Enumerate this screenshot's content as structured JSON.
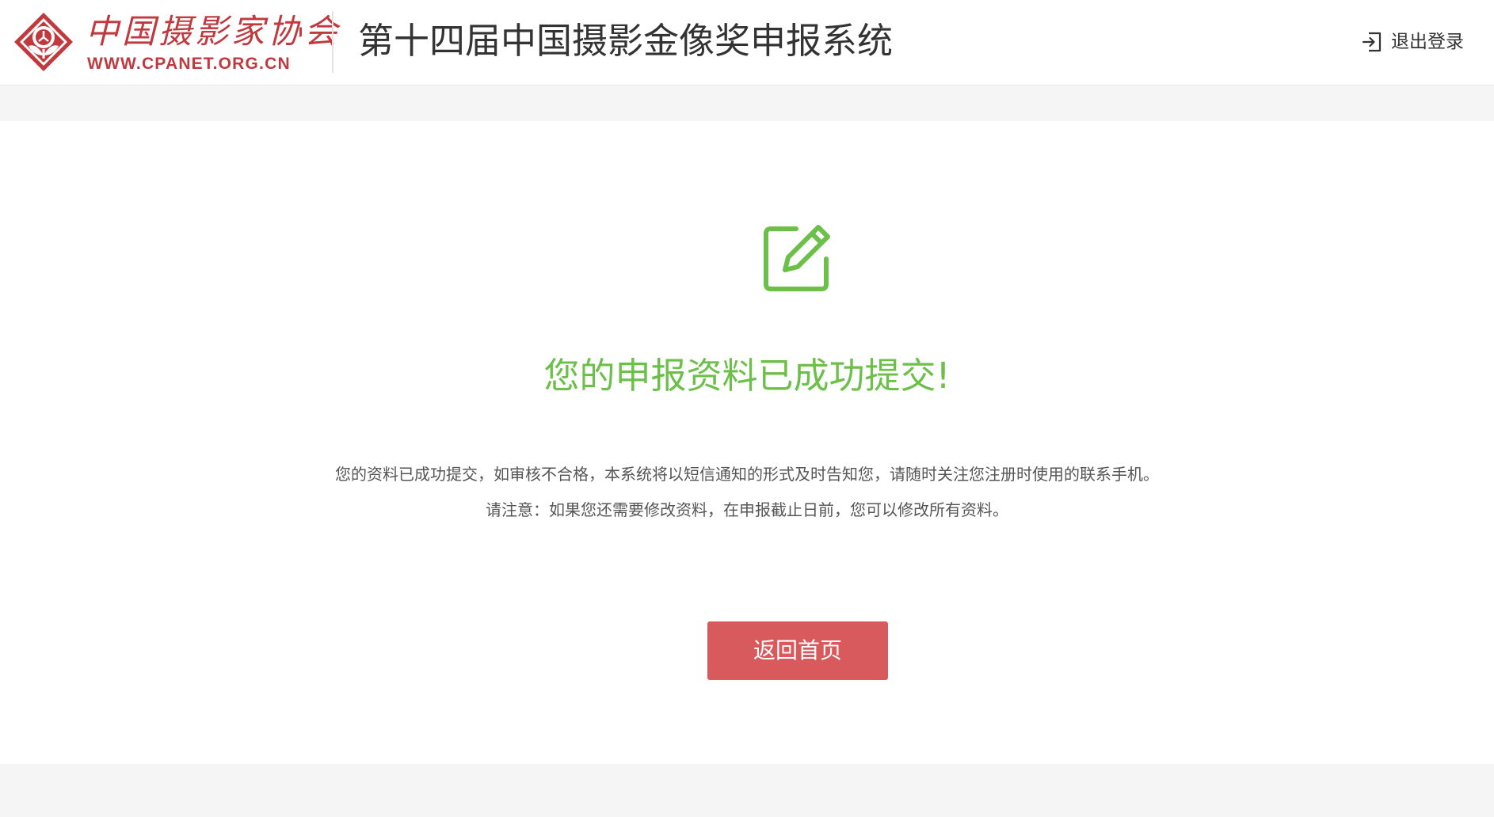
{
  "header": {
    "logo_text": "中国摄影家协会",
    "logo_url": "WWW.CPANET.ORG.CN",
    "system_title": "第十四届中国摄影金像奖申报系统",
    "logout_label": "退出登录"
  },
  "result": {
    "icon": "edit-square-icon",
    "title": "您的申报资料已成功提交!",
    "description": "您的资料已成功提交，如审核不合格，本系统将以短信通知的形式及时告知您，请随时关注您注册时使用的联系手机。",
    "note": "请注意：如果您还需要修改资料，在申报截止日前，您可以修改所有资料。",
    "home_button_label": "返回首页"
  },
  "colors": {
    "brand_red": "#c0393e",
    "success_green": "#6cc04a",
    "button_red": "#d85a5c",
    "page_background": "#f5f5f5"
  }
}
